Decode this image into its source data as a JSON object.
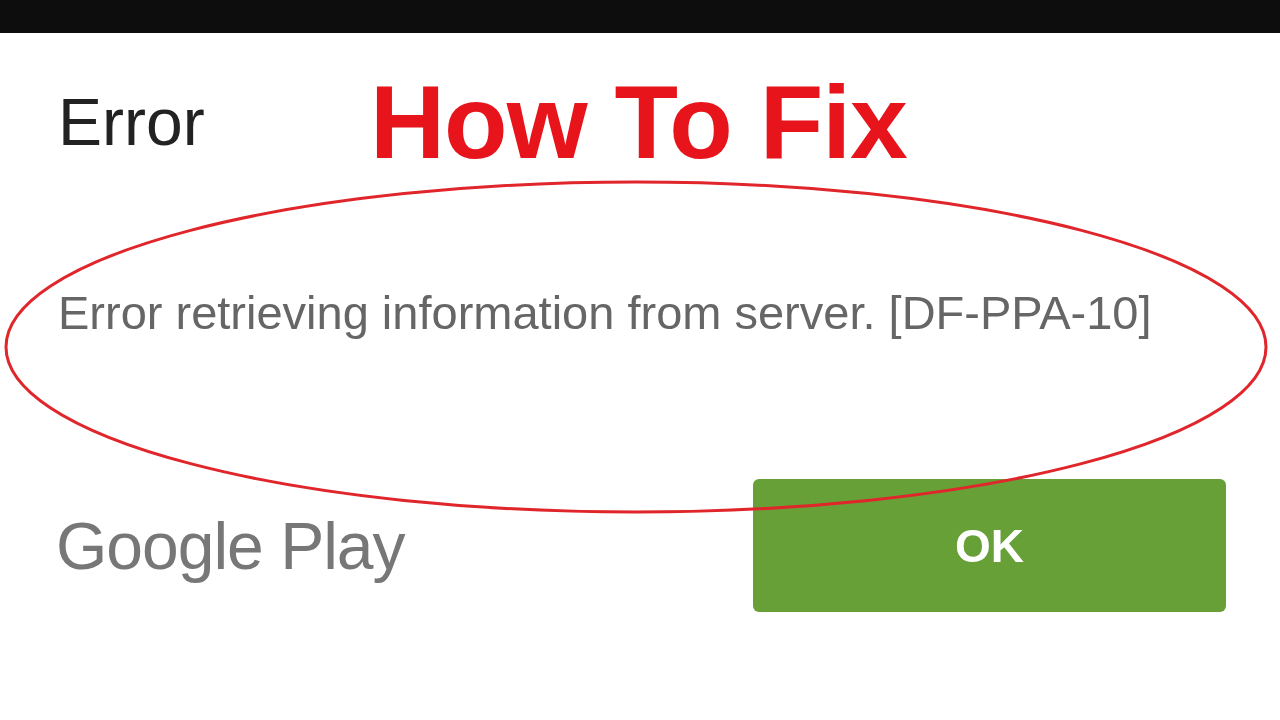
{
  "overlay": {
    "headline": "How To Fix"
  },
  "dialog": {
    "title": "Error",
    "message": "Error retrieving information from server. [DF-PPA-10]",
    "brand": "Google Play",
    "buttons": [
      {
        "label": "OK"
      }
    ]
  }
}
